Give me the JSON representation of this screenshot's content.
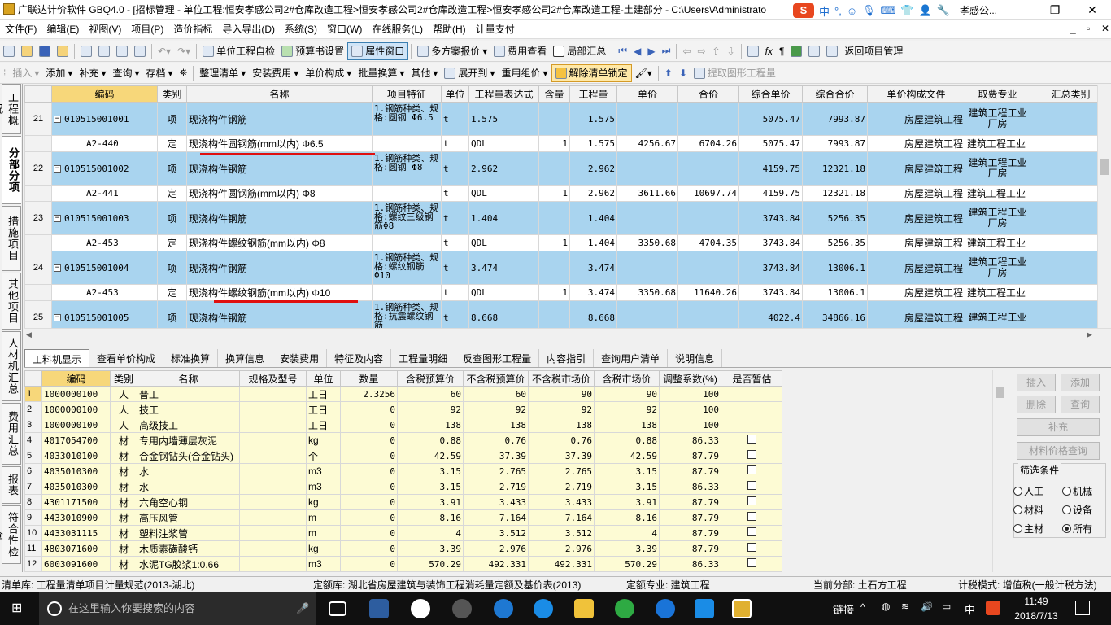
{
  "window": {
    "title": "广联达计价软件 GBQ4.0 - [招标管理 - 单位工程:恒安孝感公司2#仓库改造工程>恒安孝感公司2#仓库改造工程>恒安孝感公司2#仓库改造工程-土建部分 - C:\\Users\\Administrato",
    "title_tail": "孝感公...",
    "min": "—",
    "restore": "❐",
    "close": "✕",
    "inner_min": "_",
    "inner_restore": "▫",
    "inner_close": "✕"
  },
  "ime": {
    "logo": "S",
    "lang": "中",
    "punct": "°,",
    "emoji": "☺",
    "mic": "🎙",
    "kbd": "⌨",
    "user": "👕",
    "skin": "👤",
    "tool": "🔧"
  },
  "menu": [
    "文件(F)",
    "编辑(E)",
    "视图(V)",
    "项目(P)",
    "造价指标",
    "导入导出(D)",
    "系统(S)",
    "窗口(W)",
    "在线服务(L)",
    "帮助(H)",
    "计量支付"
  ],
  "toolbar1": {
    "check": "单位工程自检",
    "budget": "预算书设置",
    "props": "属性窗口",
    "multi": "多方案报价",
    "fee": "费用查看",
    "local": "局部汇总",
    "back": "返回项目管理"
  },
  "toolbar2": {
    "insert": "插入",
    "add": "添加",
    "supp": "补充",
    "query": "查询",
    "save": "存档",
    "tidy": "整理清单",
    "install": "安装费用",
    "unit": "单价构成",
    "batch": "批量换算",
    "other": "其他",
    "expand": "展开到",
    "reuse": "重用组价",
    "unlock": "解除清单锁定",
    "extract": "提取图形工程量"
  },
  "lefttabs": [
    "工程概况",
    "分部分项",
    "措施项目",
    "其他项目",
    "人材机汇总",
    "费用汇总",
    "报表",
    "符合性检查"
  ],
  "upper": {
    "headers": [
      "",
      "编码",
      "类别",
      "名称",
      "项目特征",
      "单位",
      "工程量表达式",
      "含量",
      "工程量",
      "单价",
      "合价",
      "综合单价",
      "综合合价",
      "单价构成文件",
      "取费专业",
      "汇总类别"
    ],
    "rows": [
      {
        "n": "21",
        "code": "010515001001",
        "type": "项",
        "name": "现浇构件钢筋",
        "feat": "1.钢筋种类、规格:圆钢 Φ6.5",
        "unit": "t",
        "expr": "1.575",
        "cont": "",
        "qty": "1.575",
        "price": "",
        "total": "",
        "cprice": "5075.47",
        "ctotal": "7993.87",
        "file": "房屋建筑工程",
        "prof": "建筑工程工业厂房"
      },
      {
        "n": "",
        "code": "A2-440",
        "type": "定",
        "name": "现浇构件圆钢筋(mm以内) Φ6.5",
        "feat": "",
        "unit": "t",
        "expr": "QDL",
        "cont": "1",
        "qty": "1.575",
        "price": "4256.67",
        "total": "6704.26",
        "cprice": "5075.47",
        "ctotal": "7993.87",
        "file": "房屋建筑工程",
        "prof": "建筑工程工业"
      },
      {
        "n": "22",
        "code": "010515001002",
        "type": "项",
        "name": "现浇构件钢筋",
        "feat": "1.钢筋种类、规格:圆钢 Φ8",
        "unit": "t",
        "expr": "2.962",
        "cont": "",
        "qty": "2.962",
        "price": "",
        "total": "",
        "cprice": "4159.75",
        "ctotal": "12321.18",
        "file": "房屋建筑工程",
        "prof": "建筑工程工业厂房"
      },
      {
        "n": "",
        "code": "A2-441",
        "type": "定",
        "name": "现浇构件圆钢筋(mm以内) Φ8",
        "feat": "",
        "unit": "t",
        "expr": "QDL",
        "cont": "1",
        "qty": "2.962",
        "price": "3611.66",
        "total": "10697.74",
        "cprice": "4159.75",
        "ctotal": "12321.18",
        "file": "房屋建筑工程",
        "prof": "建筑工程工业"
      },
      {
        "n": "23",
        "code": "010515001003",
        "type": "项",
        "name": "现浇构件钢筋",
        "feat": "1.钢筋种类、规格:螺纹三级钢筋Φ8",
        "unit": "t",
        "expr": "1.404",
        "cont": "",
        "qty": "1.404",
        "price": "",
        "total": "",
        "cprice": "3743.84",
        "ctotal": "5256.35",
        "file": "房屋建筑工程",
        "prof": "建筑工程工业厂房"
      },
      {
        "n": "",
        "code": "A2-453",
        "type": "定",
        "name": "现浇构件螺纹钢筋(mm以内) Φ8",
        "feat": "",
        "unit": "t",
        "expr": "QDL",
        "cont": "1",
        "qty": "1.404",
        "price": "3350.68",
        "total": "4704.35",
        "cprice": "3743.84",
        "ctotal": "5256.35",
        "file": "房屋建筑工程",
        "prof": "建筑工程工业"
      },
      {
        "n": "24",
        "code": "010515001004",
        "type": "项",
        "name": "现浇构件钢筋",
        "feat": "1.钢筋种类、规格:螺纹钢筋 Φ10",
        "unit": "t",
        "expr": "3.474",
        "cont": "",
        "qty": "3.474",
        "price": "",
        "total": "",
        "cprice": "3743.84",
        "ctotal": "13006.1",
        "file": "房屋建筑工程",
        "prof": "建筑工程工业厂房"
      },
      {
        "n": "",
        "code": "A2-453",
        "type": "定",
        "name": "现浇构件螺纹钢筋(mm以内) Φ10",
        "feat": "",
        "unit": "t",
        "expr": "QDL",
        "cont": "1",
        "qty": "3.474",
        "price": "3350.68",
        "total": "11640.26",
        "cprice": "3743.84",
        "ctotal": "13006.1",
        "file": "房屋建筑工程",
        "prof": "建筑工程工业"
      },
      {
        "n": "25",
        "code": "010515001005",
        "type": "项",
        "name": "现浇构件钢筋",
        "feat": "1.钢筋种类、规格:抗震螺纹钢筋",
        "unit": "t",
        "expr": "8.668",
        "cont": "",
        "qty": "8.668",
        "price": "",
        "total": "",
        "cprice": "4022.4",
        "ctotal": "34866.16",
        "file": "房屋建筑工程",
        "prof": "建筑工程工业"
      }
    ]
  },
  "bottabs": [
    "工料机显示",
    "查看单价构成",
    "标准换算",
    "换算信息",
    "安装费用",
    "特征及内容",
    "工程量明细",
    "反查图形工程量",
    "内容指引",
    "查询用户清单",
    "说明信息"
  ],
  "lower": {
    "headers": [
      "",
      "编码",
      "类别",
      "名称",
      "规格及型号",
      "单位",
      "数量",
      "含税预算价",
      "不含税预算价",
      "不含税市场价",
      "含税市场价",
      "调整系数(%)",
      "是否暂估"
    ],
    "rows": [
      {
        "n": "1",
        "code": "1000000100",
        "type": "人",
        "name": "普工",
        "spec": "",
        "unit": "工日",
        "qty": "2.3256",
        "p1": "60",
        "p2": "60",
        "p3": "90",
        "p4": "90",
        "adj": "100",
        "cb": false
      },
      {
        "n": "2",
        "code": "1000000100",
        "type": "人",
        "name": "技工",
        "spec": "",
        "unit": "工日",
        "qty": "0",
        "p1": "92",
        "p2": "92",
        "p3": "92",
        "p4": "92",
        "adj": "100",
        "cb": false
      },
      {
        "n": "3",
        "code": "1000000100",
        "type": "人",
        "name": "高级技工",
        "spec": "",
        "unit": "工日",
        "qty": "0",
        "p1": "138",
        "p2": "138",
        "p3": "138",
        "p4": "138",
        "adj": "100",
        "cb": false
      },
      {
        "n": "4",
        "code": "4017054700",
        "type": "材",
        "name": "专用内墙薄层灰泥",
        "spec": "",
        "unit": "kg",
        "qty": "0",
        "p1": "0.88",
        "p2": "0.76",
        "p3": "0.76",
        "p4": "0.88",
        "adj": "86.33",
        "cb": true
      },
      {
        "n": "5",
        "code": "4033010100",
        "type": "材",
        "name": "合金钢钻头(合金钻头)",
        "spec": "",
        "unit": "个",
        "qty": "0",
        "p1": "42.59",
        "p2": "37.39",
        "p3": "37.39",
        "p4": "42.59",
        "adj": "87.79",
        "cb": true
      },
      {
        "n": "6",
        "code": "4035010300",
        "type": "材",
        "name": "水",
        "spec": "",
        "unit": "m3",
        "qty": "0",
        "p1": "3.15",
        "p2": "2.765",
        "p3": "2.765",
        "p4": "3.15",
        "adj": "87.79",
        "cb": true
      },
      {
        "n": "7",
        "code": "4035010300",
        "type": "材",
        "name": "水",
        "spec": "",
        "unit": "m3",
        "qty": "0",
        "p1": "3.15",
        "p2": "2.719",
        "p3": "2.719",
        "p4": "3.15",
        "adj": "86.33",
        "cb": true
      },
      {
        "n": "8",
        "code": "4301171500",
        "type": "材",
        "name": "六角空心钢",
        "spec": "",
        "unit": "kg",
        "qty": "0",
        "p1": "3.91",
        "p2": "3.433",
        "p3": "3.433",
        "p4": "3.91",
        "adj": "87.79",
        "cb": true
      },
      {
        "n": "9",
        "code": "4433010900",
        "type": "材",
        "name": "高压风管",
        "spec": "",
        "unit": "m",
        "qty": "0",
        "p1": "8.16",
        "p2": "7.164",
        "p3": "7.164",
        "p4": "8.16",
        "adj": "87.79",
        "cb": true
      },
      {
        "n": "10",
        "code": "4433031115",
        "type": "材",
        "name": "塑料注浆管",
        "spec": "",
        "unit": "m",
        "qty": "0",
        "p1": "4",
        "p2": "3.512",
        "p3": "3.512",
        "p4": "4",
        "adj": "87.79",
        "cb": true
      },
      {
        "n": "11",
        "code": "4803071600",
        "type": "材",
        "name": "木质素磺酸钙",
        "spec": "",
        "unit": "kg",
        "qty": "0",
        "p1": "3.39",
        "p2": "2.976",
        "p3": "2.976",
        "p4": "3.39",
        "adj": "87.79",
        "cb": true
      },
      {
        "n": "12",
        "code": "6003091600",
        "type": "材",
        "name": "水泥TG胶浆1:0.66",
        "spec": "",
        "unit": "m3",
        "qty": "0",
        "p1": "570.29",
        "p2": "492.331",
        "p3": "492.331",
        "p4": "570.29",
        "adj": "86.33",
        "cb": true
      }
    ]
  },
  "rightpanel": {
    "insert": "插入",
    "add": "添加",
    "del": "删除",
    "query": "查询",
    "supp": "补充",
    "priceq": "材料价格查询",
    "filter": "筛选条件",
    "r_labor": "人工",
    "r_mach": "机械",
    "r_mat": "材料",
    "r_equip": "设备",
    "r_main": "主材",
    "r_all": "所有"
  },
  "status": {
    "list": "清单库: 工程量清单项目计量规范(2013-湖北)",
    "quota": "定额库: 湖北省房屋建筑与装饰工程消耗量定额及基价表(2013)",
    "spec": "定额专业: 建筑工程",
    "current": "当前分部: 土石方工程",
    "mode": "计税模式: 增值税(一般计税方法)"
  },
  "taskbar": {
    "search": "在这里输入你要搜索的内容",
    "link": "链接",
    "lang": "中",
    "time": "11:49",
    "date": "2018/7/13"
  }
}
